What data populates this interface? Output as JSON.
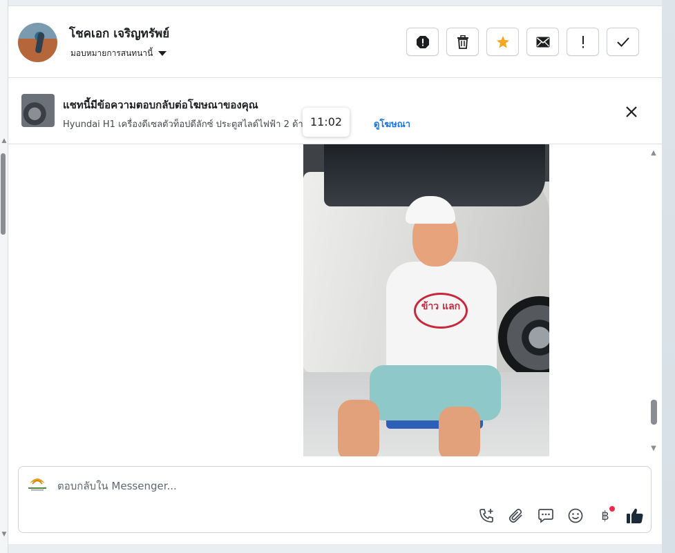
{
  "conversation": {
    "contact_name": "โชคเอก เจริญทรัพย์",
    "assign_label": "มอบหมายการสนทนานี้"
  },
  "header_actions": [
    {
      "icon": "alert-octagon-icon",
      "color": "#1c1e21"
    },
    {
      "icon": "trash-icon",
      "color": "#1c1e21"
    },
    {
      "icon": "star-icon",
      "color": "#f5a623"
    },
    {
      "icon": "envelope-icon",
      "color": "#1c1e21"
    },
    {
      "icon": "exclamation-icon",
      "color": "#1c1e21"
    },
    {
      "icon": "check-icon",
      "color": "#1c1e21"
    }
  ],
  "ad_banner": {
    "title": "แชทนี้มีข้อความตอบกลับต่อโฆษณาของคุณ",
    "description": "Hyundai H1 เครื่องดีเซลตัวท็อปดีลักซ์ ประตูสไลด์ไฟฟ้า 2 ด้าน D...",
    "link_label": "ดูโฆษณา"
  },
  "message": {
    "timestamp_tooltip": "11:02",
    "photo_caption_logo": "ข้าว แลก"
  },
  "composer": {
    "placeholder": "ตอบกลับใน Messenger...",
    "tools": [
      "phone-plus-icon",
      "paperclip-icon",
      "chat-bubble-icon",
      "emoji-icon",
      "baht-icon",
      "thumbs-up-icon"
    ],
    "baht_symbol": "฿",
    "accent_color": "#f02849",
    "like_color": "#1c2b3a"
  }
}
